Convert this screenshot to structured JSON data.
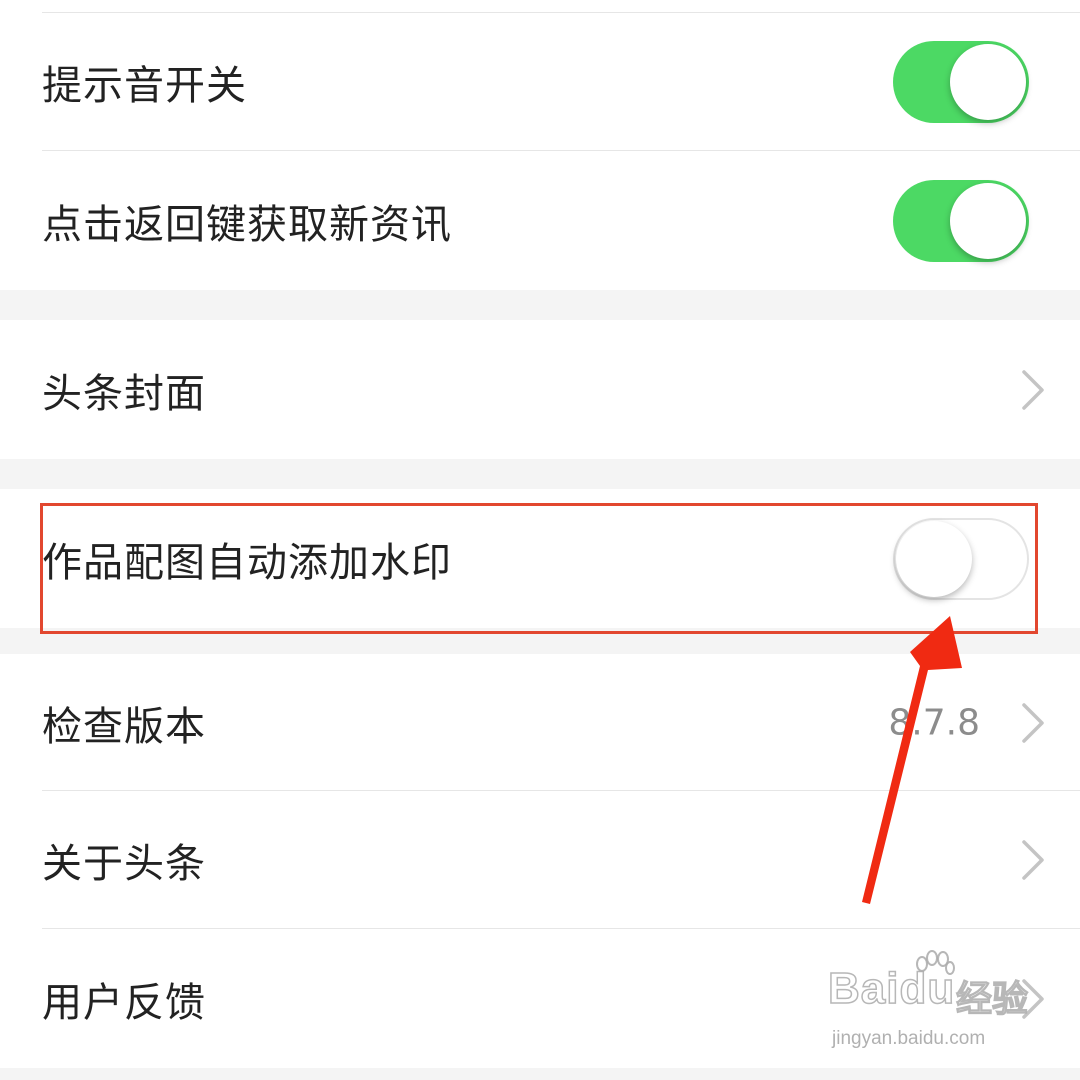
{
  "settings": {
    "sound_toggle": {
      "label": "提示音开关",
      "enabled": true
    },
    "back_refresh_toggle": {
      "label": "点击返回键获取新资讯",
      "enabled": true
    },
    "cover_item": {
      "label": "头条封面"
    },
    "watermark_toggle": {
      "label": "作品配图自动添加水印",
      "enabled": false
    },
    "check_version": {
      "label": "检查版本",
      "value": "8.7.8"
    },
    "about": {
      "label": "关于头条"
    },
    "feedback": {
      "label": "用户反馈"
    }
  },
  "annotation": {
    "highlight_color": "#e2472f",
    "arrow_color": "#f02a12"
  },
  "watermark": {
    "brand": "Baidu",
    "sub": "经验",
    "url": "jingyan.baidu.com"
  },
  "colors": {
    "toggle_on": "#4cd964",
    "background": "#f4f4f4"
  }
}
